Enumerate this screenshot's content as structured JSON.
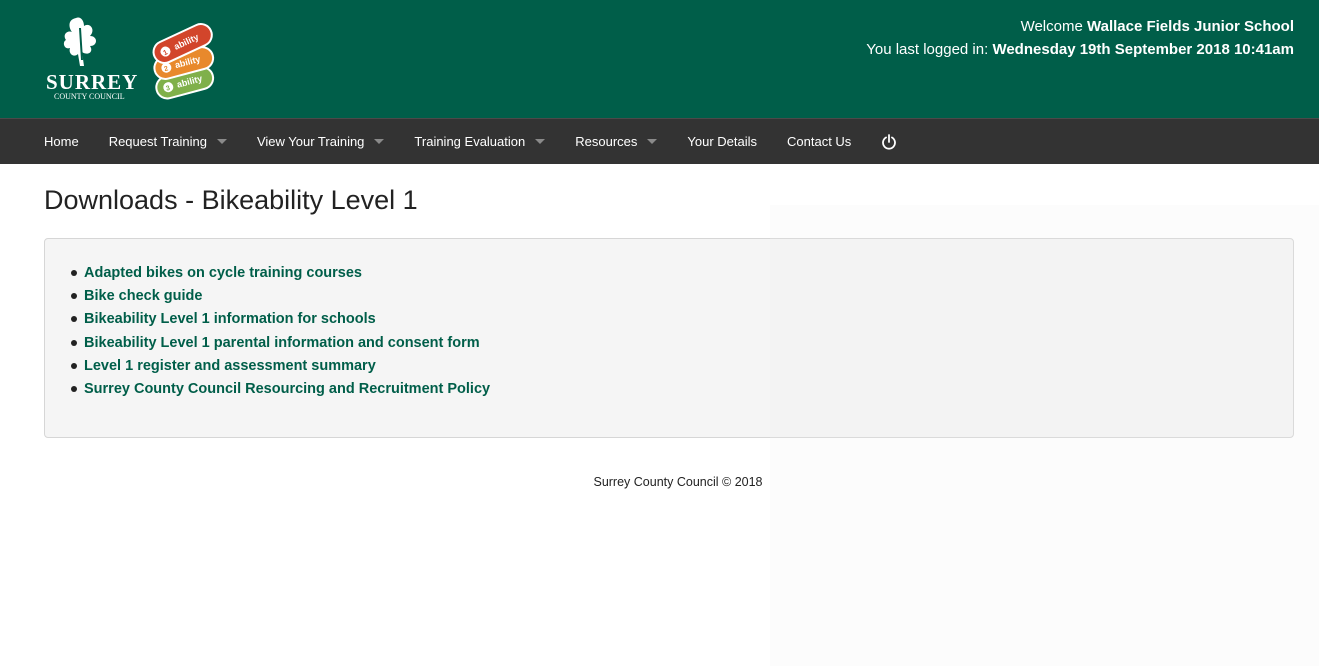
{
  "header": {
    "logo": {
      "brand_name": "SURREY",
      "brand_sub": "COUNTY COUNCIL",
      "badge_text": "ability",
      "badge_levels": [
        "1",
        "2",
        "3"
      ]
    },
    "welcome_prefix": "Welcome",
    "user_name": "Wallace Fields Junior School",
    "last_login_prefix": "You last logged in:",
    "last_login_value": "Wednesday 19th September 2018 10:41am"
  },
  "nav": {
    "items": [
      {
        "label": "Home",
        "dropdown": false
      },
      {
        "label": "Request Training",
        "dropdown": true
      },
      {
        "label": "View Your Training",
        "dropdown": true
      },
      {
        "label": "Training Evaluation",
        "dropdown": true
      },
      {
        "label": "Resources",
        "dropdown": true
      },
      {
        "label": "Your Details",
        "dropdown": false
      },
      {
        "label": "Contact Us",
        "dropdown": false
      }
    ],
    "power_icon": "power-icon"
  },
  "page": {
    "title": "Downloads - Bikeability Level 1",
    "downloads": [
      "Adapted bikes on cycle training courses",
      "Bike check guide",
      "Bikeability Level 1 information for schools",
      "Bikeability Level 1 parental information and consent form",
      "Level 1 register and assessment summary",
      "Surrey County Council Resourcing and Recruitment Policy"
    ]
  },
  "footer": {
    "text": "Surrey County Council © 2018"
  },
  "colors": {
    "brand_green": "#005e49",
    "navbar": "#333333",
    "link": "#005e49",
    "badge_red": "#d2452b",
    "badge_orange": "#e8892c",
    "badge_green": "#7fb04a"
  }
}
